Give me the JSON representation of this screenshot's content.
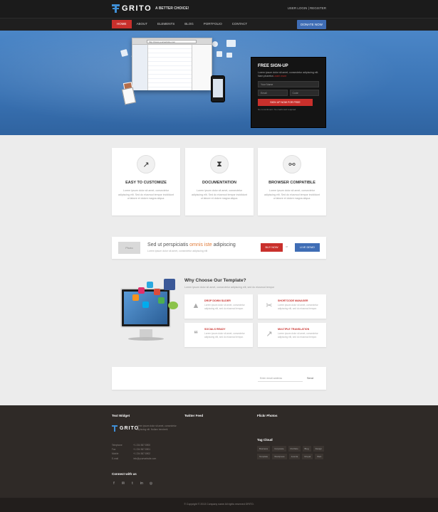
{
  "header": {
    "logo": "GRITO",
    "tagline": "A BETTER CHOICE!",
    "top_links": "USER LOGIN  |  REGISTER",
    "nav": [
      "HOME",
      "ABOUT",
      "ELEMENTS",
      "BLOG",
      "PORTFOLIO",
      "CONTACT"
    ],
    "donate": "DONATE NOW"
  },
  "hero": {
    "browser_url": "http://www.yourwebsite.com",
    "signup": {
      "title": "FREE SIGN-UP",
      "text": "Lorem ipsum dolor sit amet, consectetur adipiscing elit. Nam pharetra",
      "link": "Learn more",
      "field_name": "Your Name",
      "field_email": "Email",
      "field_code": "Code",
      "button": "SIGN UP NOW FOR FREE",
      "note": "No commitment. No credit card required."
    }
  },
  "features": [
    {
      "icon": "↗",
      "title": "EASY TO CUSTOMIZE",
      "text": "Lorem ipsum dolor sit amet, consectetur adipiscing elit. Sed do eiusmod tempor incididunt ut labore et dolore magna aliqua."
    },
    {
      "icon": "⧗",
      "title": "DOCUMENTATION",
      "text": "Lorem ipsum dolor sit amet, consectetur adipiscing elit. Sed do eiusmod tempor incididunt ut labore et dolore magna aliqua."
    },
    {
      "icon": "⚯",
      "title": "BROWSER COMPATIBLE",
      "text": "Lorem ipsum dolor sit amet, consectetur adipiscing elit. Sed do eiusmod tempor incididunt ut labore et dolore magna aliqua."
    }
  ],
  "cta": {
    "thumb": "Photo",
    "title_pre": "Sed ut perspiciatis ",
    "title_accent": "omnis iste",
    "title_post": " adipiscing",
    "subtitle": "Lorem ipsum dolor sit amet, consectetur adipiscing elit",
    "buy": "BUY NOW",
    "or": "or",
    "demo": "LIVE DEMO"
  },
  "why": {
    "title": "Why Choose Our Template?",
    "subtitle": "Lorem ipsum dolor sit amet, consectetur adipiscing elit, sed do eiusmod tempor",
    "items": [
      {
        "icon": "▲",
        "title": "DROP DOWN SLIDER",
        "text": "Lorem ipsum dolor sit amet, consectetur adipiscing elit, sed do eiusmod tempor."
      },
      {
        "icon": "✂",
        "title": "SHORTCODE MANAGER",
        "text": "Lorem ipsum dolor sit amet, consectetur adipiscing elit, sed do eiusmod tempor."
      },
      {
        "icon": "❝",
        "title": "SOCIALS READY",
        "text": "Lorem ipsum dolor sit amet, consectetur adipiscing elit, sed do eiusmod tempor."
      },
      {
        "icon": "↗",
        "title": "MULTIPLE TRANSLATION",
        "text": "Lorem ipsum dolor sit amet, consectetur adipiscing elit, sed do eiusmod tempor."
      }
    ]
  },
  "newsletter": {
    "placeholder": "Enter email address",
    "send": "Send"
  },
  "footer": {
    "col1_title": "Text Widget",
    "col2_title": "Twitter Feed",
    "col3_title": "Flickr Photos",
    "logo": "GRITO",
    "desc": "Lorem ipsum dolor sit amet, consectetur adipiscing elit. Nullam hendrerit.",
    "contact": [
      {
        "label": "Telephone",
        "value": "+1 234 567 8900"
      },
      {
        "label": "Fax",
        "value": "+1 234 567 8901"
      },
      {
        "label": "Mobile",
        "value": "+1 234 567 8902"
      },
      {
        "label": "E-mail",
        "value": "info@yourwebsite.com"
      }
    ],
    "connect_title": "Connect with us",
    "social": [
      "f",
      "✉",
      "t",
      "in",
      "◎"
    ],
    "tag_cloud_title": "Tag Cloud",
    "tags": [
      "Business",
      "Corporate",
      "Portfolio",
      "Blog",
      "Design",
      "Template",
      "Wordpress",
      "Joomla",
      "Drupal",
      "Web"
    ],
    "copyright": "© Copyright © 2013 Company name All rights reserved GRITO."
  }
}
